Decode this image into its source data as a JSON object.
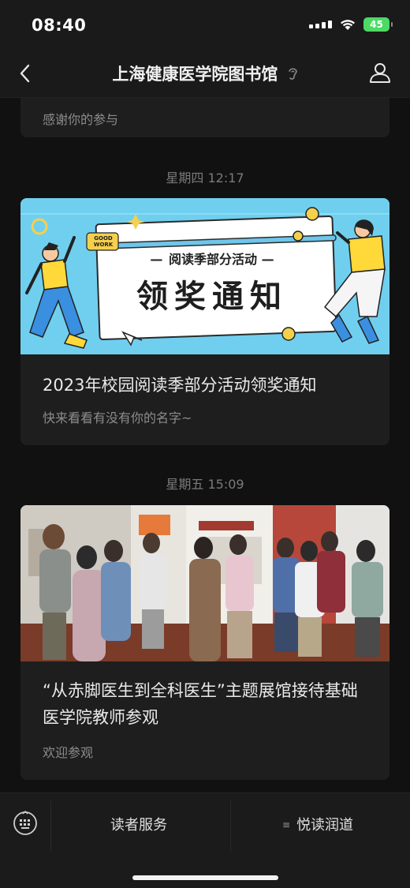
{
  "status_bar": {
    "time": "08:40",
    "battery": "45"
  },
  "nav": {
    "title": "上海健康医学院图书馆"
  },
  "feed": {
    "prev_card_desc": "感谢你的参与",
    "items": [
      {
        "timestamp": "星期四 12:17",
        "banner": {
          "subtitle": "阅读季部分活动",
          "title": "领奖通知",
          "badge": "GOOD WORK"
        },
        "title": "2023年校园阅读季部分活动领奖通知",
        "desc": "快来看看有没有你的名字~"
      },
      {
        "timestamp": "星期五 15:09",
        "title": "“从赤脚医生到全科医生”主题展馆接待基础医学院教师参观",
        "desc": "欢迎参观"
      }
    ]
  },
  "bottom_menu": {
    "item1": "读者服务",
    "item2": "悦读润道"
  }
}
